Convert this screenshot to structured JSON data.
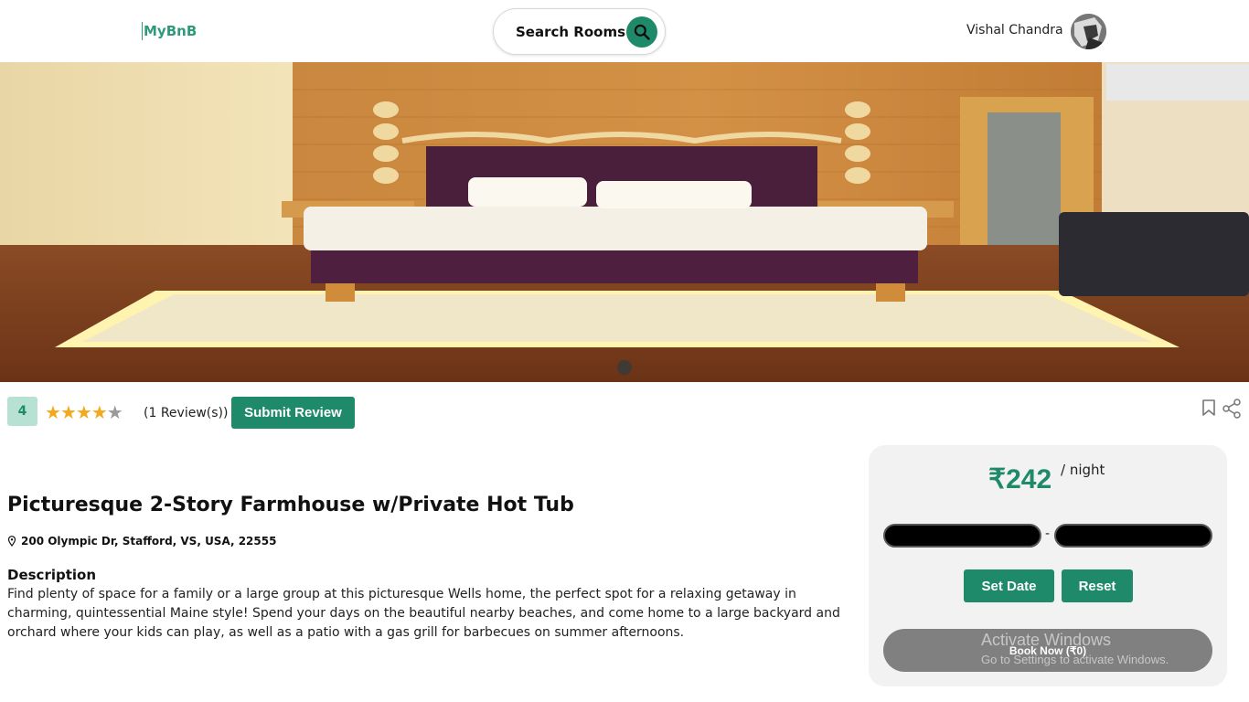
{
  "header": {
    "logo": "MyBnB",
    "search_label": "Search Rooms",
    "user_name": "Vishal Chandra"
  },
  "listing": {
    "rating_value": "4",
    "stars": 4,
    "stars_max": 5,
    "review_count": "(1 Review(s))",
    "submit_review_label": "Submit Review",
    "title": "Picturesque 2-Story Farmhouse w/Private Hot Tub",
    "address": "200 Olympic Dr, Stafford, VS, USA, 22555",
    "description_heading": "Description",
    "description": "Find plenty of space for a family or a large group at this picturesque Wells home, the perfect spot for a relaxing getaway in charming, quintessential Maine style! Spend your days on the beautiful nearby beaches, and come home to a large backyard and orchard where your kids can play, as well as a patio with a gas grill for barbecues on summer afternoons."
  },
  "booking": {
    "price": "₹242",
    "per_night": "/ night",
    "date_separator": "-",
    "set_date_label": "Set Date",
    "reset_label": "Reset",
    "book_now_label": "Book Now (₹0)"
  },
  "watermark": {
    "title": "Activate Windows",
    "subtitle": "Go to Settings to activate Windows."
  },
  "colors": {
    "accent": "#1f8a69",
    "rating_bg": "#b7e2d3",
    "star": "#f4a81c"
  },
  "icons": [
    "search-icon",
    "location-pin-icon",
    "bookmark-icon",
    "share-icon",
    "star-icon"
  ]
}
